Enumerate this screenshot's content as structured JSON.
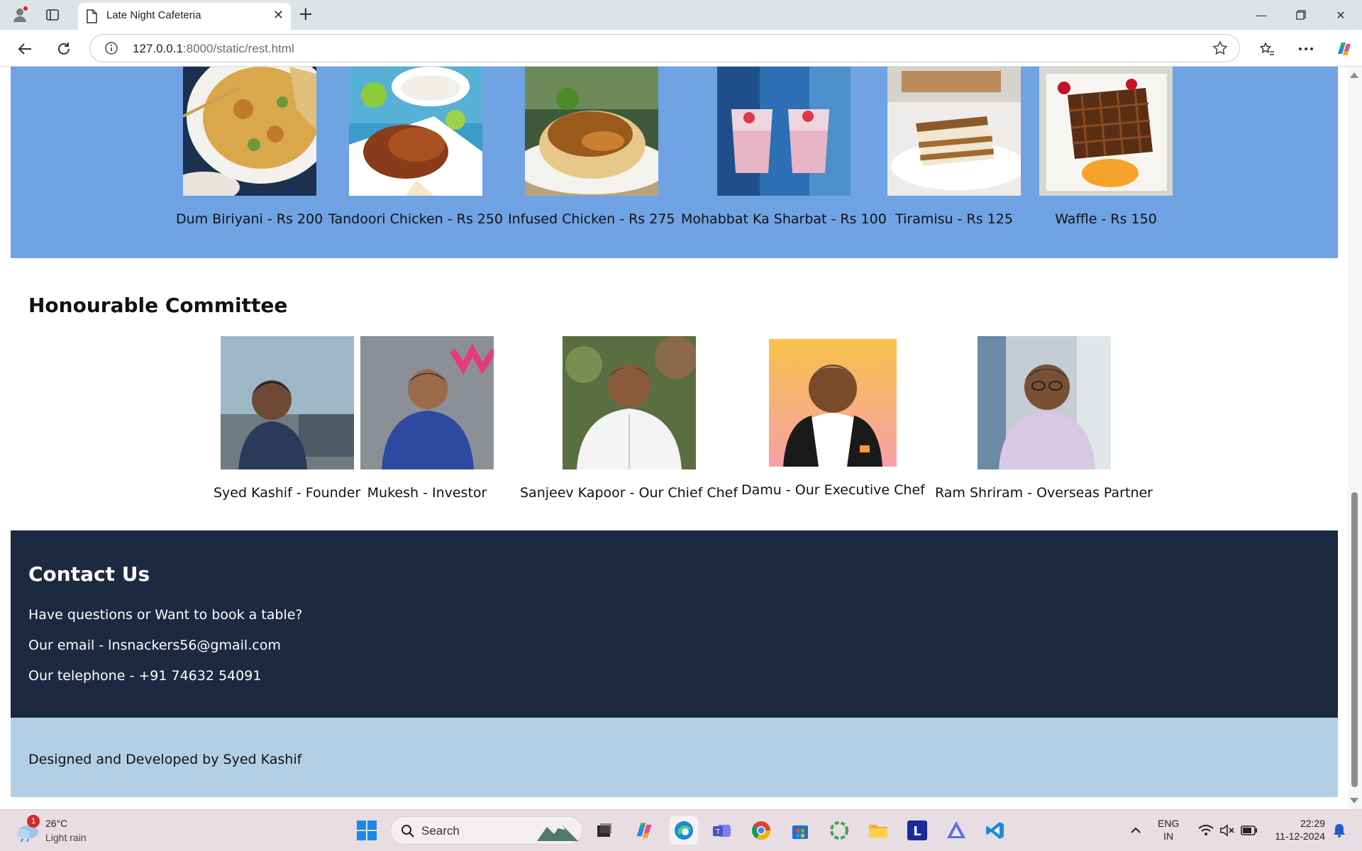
{
  "browser": {
    "tab_title": "Late Night Cafeteria",
    "url_host": "127.0.0.1",
    "url_rest": ":8000/static/rest.html"
  },
  "menu": {
    "items": [
      {
        "caption": "Dum Biriyani - Rs 200"
      },
      {
        "caption": "Tandoori Chicken - Rs 250"
      },
      {
        "caption": "Infused Chicken - Rs 275"
      },
      {
        "caption": "Mohabbat Ka Sharbat - Rs 100"
      },
      {
        "caption": "Tiramisu - Rs 125"
      },
      {
        "caption": "Waffle - Rs 150"
      }
    ]
  },
  "committee": {
    "title": "Honourable Committee",
    "members": [
      {
        "caption": "Syed Kashif - Founder"
      },
      {
        "caption": "Mukesh - Investor"
      },
      {
        "caption": "Sanjeev Kapoor - Our Chief Chef"
      },
      {
        "caption": "Damu - Our Executive Chef"
      },
      {
        "caption": "Ram Shriram - Overseas Partner"
      }
    ]
  },
  "contact": {
    "title": "Contact Us",
    "question": "Have questions or Want to book a table?",
    "email": "Our email - lnsnackers56@gmail.com",
    "phone": "Our telephone - +91 74632 54091"
  },
  "footer": {
    "text": "Designed and Developed by Syed Kashif"
  },
  "taskbar": {
    "weather_temp": "26°C",
    "weather_cond": "Light rain",
    "weather_badge": "1",
    "search_label": "Search",
    "lang_1": "ENG",
    "lang_2": "IN",
    "time": "22:29",
    "date": "11-12-2024"
  },
  "colors": {
    "menu_bg": "#6fa3e3",
    "contact_bg": "#1c2940",
    "footer_bg": "#b3cfe6"
  }
}
